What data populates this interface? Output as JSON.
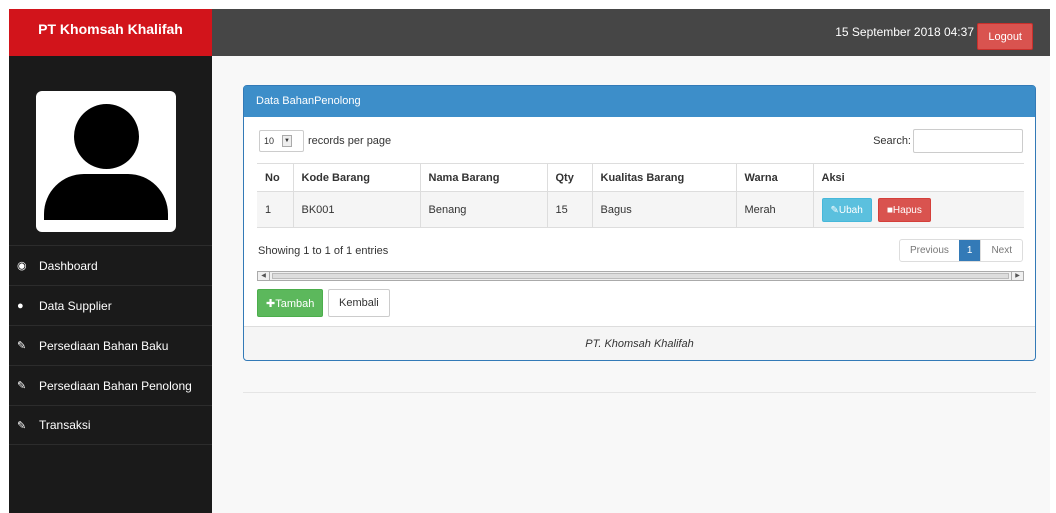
{
  "header": {
    "brand": "PT Khomsah Khalifah",
    "datetime": "15 September 2018 04:37",
    "logout_label": "Logout"
  },
  "sidebar": {
    "items": [
      {
        "label": "Dashboard",
        "icon": "dashboard-icon"
      },
      {
        "label": "Data Supplier",
        "icon": "user-icon"
      },
      {
        "label": "Persediaan Bahan Baku",
        "icon": "edit-icon"
      },
      {
        "label": "Persediaan Bahan Penolong",
        "icon": "edit-icon"
      },
      {
        "label": "Transaksi",
        "icon": "edit-icon"
      }
    ]
  },
  "panel": {
    "title": "Data BahanPenolong",
    "length_value": "10",
    "length_suffix": "records per page",
    "search_label": "Search:",
    "search_value": "",
    "columns": [
      "No",
      "Kode Barang",
      "Nama Barang",
      "Qty",
      "Kualitas Barang",
      "Warna",
      "Aksi"
    ],
    "rows": [
      {
        "no": "1",
        "kode": "BK001",
        "nama": "Benang",
        "qty": "15",
        "kualitas": "Bagus",
        "warna": "Merah",
        "edit_label": "Ubah",
        "delete_label": "Hapus"
      }
    ],
    "info": "Showing 1 to 1 of 1 entries",
    "pager": {
      "prev": "Previous",
      "current": "1",
      "next": "Next"
    },
    "add_label": "Tambah",
    "back_label": "Kembali",
    "footer": "PT. Khomsah Khalifah"
  },
  "colors": {
    "brand": "#d2141b",
    "topbar": "#464646",
    "sidebar": "#1a1a1a",
    "panel_heading": "#3d8ec9",
    "success": "#5cb85c",
    "danger": "#d9534f",
    "info": "#5bc0de"
  }
}
